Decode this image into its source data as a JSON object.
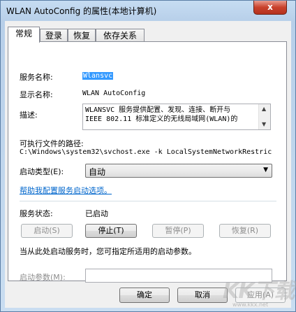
{
  "window": {
    "title": "WLAN AutoConfig 的属性(本地计算机)",
    "close_label": "x"
  },
  "tabs": [
    {
      "label": "常规",
      "active": true
    },
    {
      "label": "登录",
      "active": false
    },
    {
      "label": "恢复",
      "active": false
    },
    {
      "label": "依存关系",
      "active": false
    }
  ],
  "general": {
    "service_name_label": "服务名称:",
    "service_name_value": "Wlansvc",
    "display_name_label": "显示名称:",
    "display_name_value": "WLAN AutoConfig",
    "description_label": "描述:",
    "description_lines": [
      "WLANSVC 服务提供配置、发现、连接、断开与",
      "IEEE 802.11 标准定义的无线局域网(WLAN)的"
    ],
    "exe_path_label": "可执行文件的路径:",
    "exe_path_value": "C:\\Windows\\system32\\svchost.exe -k LocalSystemNetworkRestric",
    "startup_type_label": "启动类型(E):",
    "startup_type_value": "自动",
    "help_link": "帮助我配置服务启动选项。",
    "service_status_label": "服务状态:",
    "service_status_value": "已启动",
    "start_button": "启动(S)",
    "stop_button": "停止(T)",
    "pause_button": "暂停(P)",
    "resume_button": "恢复(R)",
    "start_params_hint": "当从此处启动服务时，您可指定所适用的启动参数。",
    "start_params_label": "启动参数(M):",
    "start_params_value": ""
  },
  "footer": {
    "ok_button": "确定",
    "cancel_button": "取消",
    "apply_button": "应用(A)"
  },
  "watermark": {
    "text": "KK下载",
    "url": "www.kkx.net"
  }
}
